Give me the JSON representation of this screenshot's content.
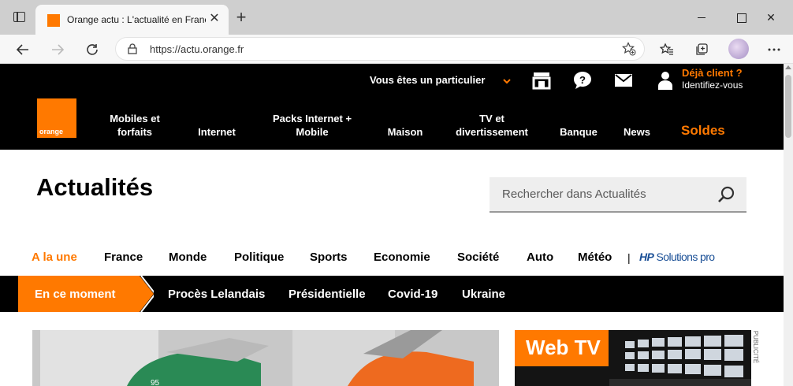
{
  "browser": {
    "tab_title": "Orange actu : L'actualité en France",
    "url": "https://actu.orange.fr",
    "icons": [
      "window-menu-icon",
      "new-tab-icon",
      "back-icon",
      "forward-icon",
      "refresh-icon",
      "lock-icon",
      "add-favorite-icon",
      "favorites-icon",
      "collections-icon",
      "profile-icon",
      "more-icon"
    ]
  },
  "header": {
    "particulier": "Vous êtes un particulier",
    "client_title": "Déjà client ?",
    "client_sub": "Identifiez-vous",
    "logo_text": "orange",
    "nav": [
      {
        "label": "Mobiles et forfaits"
      },
      {
        "label": "Internet"
      },
      {
        "label": "Packs Internet + Mobile"
      },
      {
        "label": "Maison"
      },
      {
        "label": "TV et divertissement"
      },
      {
        "label": "Banque"
      },
      {
        "label": "News"
      }
    ],
    "soldes": "Soldes"
  },
  "main": {
    "title": "Actualités",
    "search_placeholder": "Rechercher dans Actualités",
    "categories": [
      "A la une",
      "France",
      "Monde",
      "Politique",
      "Sports",
      "Economie",
      "Société",
      "Auto",
      "Météo"
    ],
    "separator": "|",
    "hp_logo": "Solutions pro",
    "hp_logo_prefix": "HP",
    "moment_label": "En ce moment",
    "topics": [
      "Procès Lelandais",
      "Présidentielle",
      "Covid-19",
      "Ukraine"
    ],
    "webtv_label": "Web TV",
    "pub_label": "PUBLICITÉ"
  },
  "colors": {
    "brand_orange": "#ff7900",
    "header_bg": "#000000"
  }
}
